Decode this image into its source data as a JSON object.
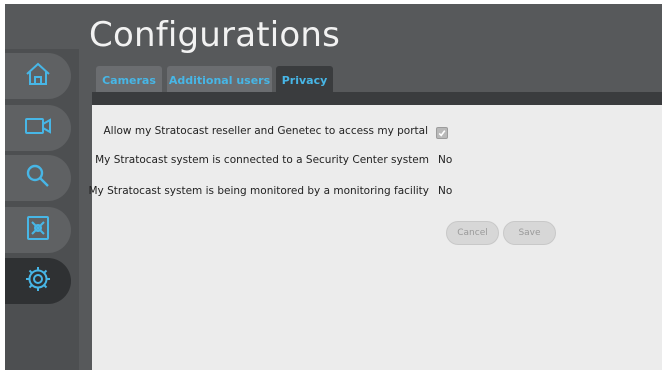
{
  "header": {
    "title": "Configurations"
  },
  "nav": [
    {
      "name": "home-icon",
      "active": false
    },
    {
      "name": "camera-icon",
      "active": false
    },
    {
      "name": "search-icon",
      "active": false
    },
    {
      "name": "archive-icon",
      "active": false
    },
    {
      "name": "gear-icon",
      "active": true
    }
  ],
  "tabs": [
    {
      "label": "Cameras",
      "active": false
    },
    {
      "label": "Additional users",
      "active": false
    },
    {
      "label": "Privacy",
      "active": true
    }
  ],
  "privacy": {
    "rows": [
      {
        "label": "Allow my Stratocast reseller and Genetec to access my portal",
        "checked": true
      },
      {
        "label": "My Stratocast system is connected to a Security Center system",
        "value": "No"
      },
      {
        "label": "My Stratocast system is being monitored by a monitoring facility",
        "value": "No"
      }
    ],
    "cancel_label": "Cancel",
    "save_label": "Save"
  },
  "colors": {
    "accent": "#47b6e6",
    "frame": "#57595b",
    "panel": "#ececec",
    "nav_active": "#2f3133"
  }
}
